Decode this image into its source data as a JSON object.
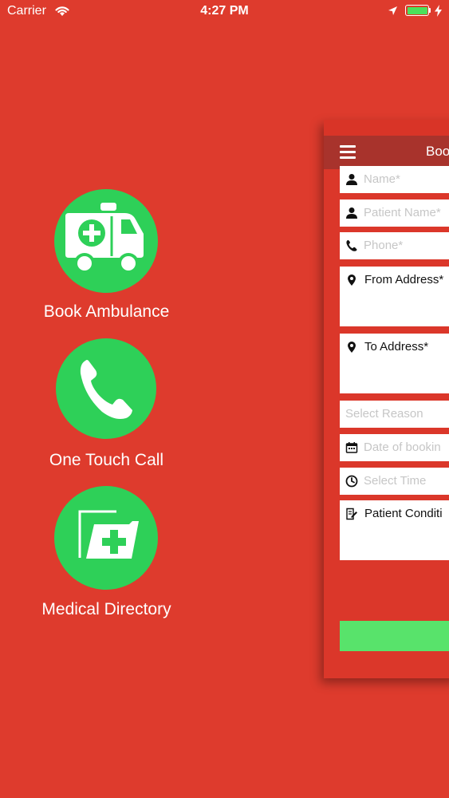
{
  "status_bar": {
    "carrier": "Carrier",
    "time": "4:27 PM"
  },
  "menu": {
    "items": [
      {
        "label": "Book Ambulance",
        "icon": "ambulance-icon"
      },
      {
        "label": "One Touch Call",
        "icon": "phone-icon"
      },
      {
        "label": "Medical Directory",
        "icon": "medical-folder-icon"
      }
    ]
  },
  "panel": {
    "title": "Boo",
    "fields": {
      "name": "Name*",
      "patient_name": "Patient Name*",
      "phone": "Phone*",
      "from_address": "From Address*",
      "to_address": "To Address*",
      "reason": "Select Reason",
      "date": "Date of bookin",
      "time": "Select Time",
      "condition": "Patient Conditi"
    }
  },
  "colors": {
    "background": "#de3b2d",
    "header": "#a8332c",
    "menu_circle": "#2ed058",
    "submit": "#58e36b"
  }
}
